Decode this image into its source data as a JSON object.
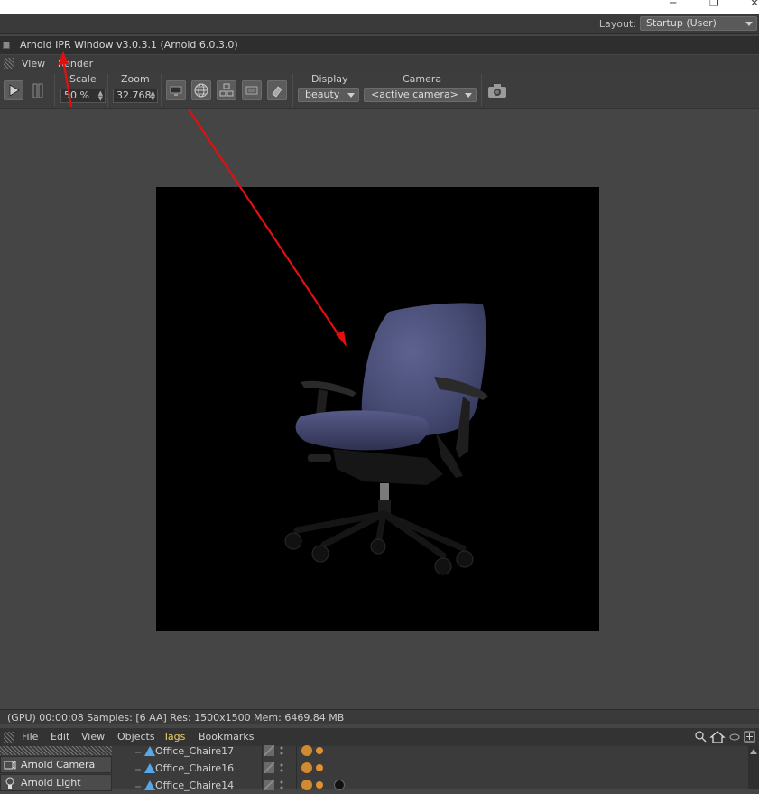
{
  "window_controls": {
    "minimize": "─",
    "maximize": "❐",
    "close": "✕"
  },
  "layout": {
    "label": "Layout:",
    "value": "Startup (User)"
  },
  "ipr": {
    "title": "Arnold IPR Window v3.0.3.1 (Arnold 6.0.3.0)"
  },
  "menu": {
    "view": "View",
    "render": "Render"
  },
  "toolbar": {
    "scale_label": "Scale",
    "scale_value": "50 %",
    "zoom_label": "Zoom",
    "zoom_value": "32.768",
    "display_label": "Display",
    "display_value": "beauty",
    "camera_label": "Camera",
    "camera_value": "<active camera>"
  },
  "status": {
    "text": "(GPU) 00:00:08  Samples: [6 AA]  Res: 1500x1500  Mem: 6469.84 MB"
  },
  "object_manager": {
    "menu": [
      "File",
      "Edit",
      "View",
      "Objects",
      "Tags",
      "Bookmarks"
    ],
    "active_menu": "Tags",
    "left_items": [
      "Arnold Camera",
      "Arnold Light"
    ],
    "objects": [
      "Office_Chaire17",
      "Office_Chaire16",
      "Office_Chaire14"
    ]
  },
  "colors": {
    "annotation_arrow": "#e01010",
    "tags_highlight": "#f0d060",
    "chair_fabric": "#4a4e78"
  }
}
